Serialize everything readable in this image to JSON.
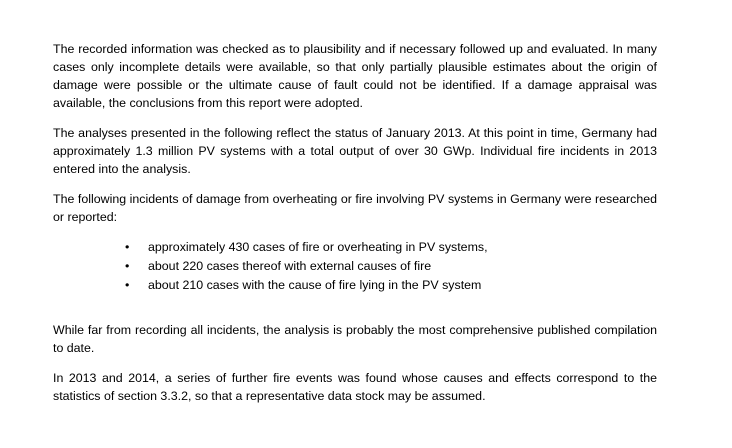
{
  "document": {
    "paragraphs": [
      "The recorded information was checked as to plausibility and if necessary followed up and evaluated. In many cases only incomplete details were available, so that only partially plausible estimates about the origin of damage were possible or the ultimate cause of fault could not be identified. If a damage appraisal was available, the conclusions from this report were adopted.",
      "The analyses presented in the following reflect the status of January 2013. At this point in time, Germany had approximately 1.3 million PV systems with a total output of over 30 GWp. Individual fire incidents in 2013 entered into the analysis.",
      "The following incidents of damage from overheating or fire involving PV systems in Germany were researched or reported:",
      "While far from recording all incidents, the analysis is probably the most comprehensive published compilation to date.",
      "In 2013 and 2014, a series of further fire events was found whose causes and effects correspond to the statistics of section 3.3.2, so that a representative data stock may be assumed."
    ],
    "bullet_glyph": "•",
    "bullets": [
      "approximately 430 cases of fire or overheating in PV systems,",
      "about 220 cases thereof with external causes of fire",
      "about 210 cases with the cause of fire lying in the PV system"
    ]
  }
}
